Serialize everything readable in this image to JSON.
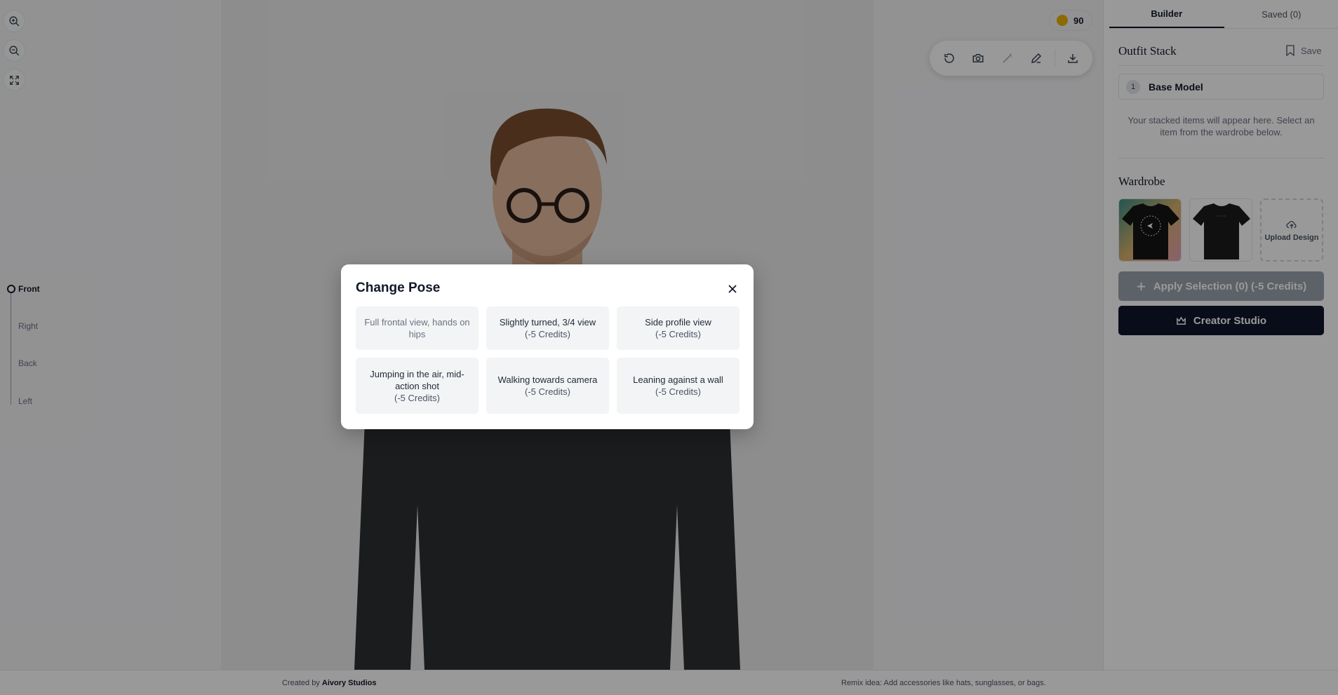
{
  "canvas": {
    "credits": "90",
    "views": [
      {
        "label": "Front",
        "active": true
      },
      {
        "label": "Right",
        "active": false
      },
      {
        "label": "Back",
        "active": false
      },
      {
        "label": "Left",
        "active": false
      }
    ],
    "tools": [
      "rotate-icon",
      "camera-icon",
      "wand-icon",
      "pencil-icon",
      "download-icon"
    ]
  },
  "footer": {
    "created_prefix": "Created by",
    "created_brand": "Aivory Studios",
    "remix": "Remix idea: Add accessories like hats, sunglasses, or bags."
  },
  "panel": {
    "tabs": [
      {
        "label": "Builder",
        "active": true
      },
      {
        "label": "Saved (0)",
        "active": false
      }
    ],
    "outfit_title": "Outfit Stack",
    "save_label": "Save",
    "stack_items": [
      {
        "num": "1",
        "label": "Base Model"
      }
    ],
    "stack_hint": "Your stacked items will appear here. Select an item from the wardrobe below.",
    "wardrobe_title": "Wardrobe",
    "upload_label": "Upload Design",
    "apply_label": "Apply Selection (0) (-5 Credits)",
    "studio_label": "Creator Studio"
  },
  "modal": {
    "title": "Change Pose",
    "poses": [
      {
        "label": "Full frontal view, hands on hips",
        "cost": "",
        "current": true
      },
      {
        "label": "Slightly turned, 3/4 view",
        "cost": "(-5 Credits)",
        "current": false
      },
      {
        "label": "Side profile view",
        "cost": "(-5 Credits)",
        "current": false
      },
      {
        "label": "Jumping in the air, mid-action shot",
        "cost": "(-5 Credits)",
        "current": false
      },
      {
        "label": "Walking towards camera",
        "cost": "(-5 Credits)",
        "current": false
      },
      {
        "label": "Leaning against a wall",
        "cost": "(-5 Credits)",
        "current": false
      }
    ]
  },
  "colors": {
    "accent_dark": "#0f172a",
    "coin": "#eab308",
    "disabled_button": "#9ca3af"
  }
}
